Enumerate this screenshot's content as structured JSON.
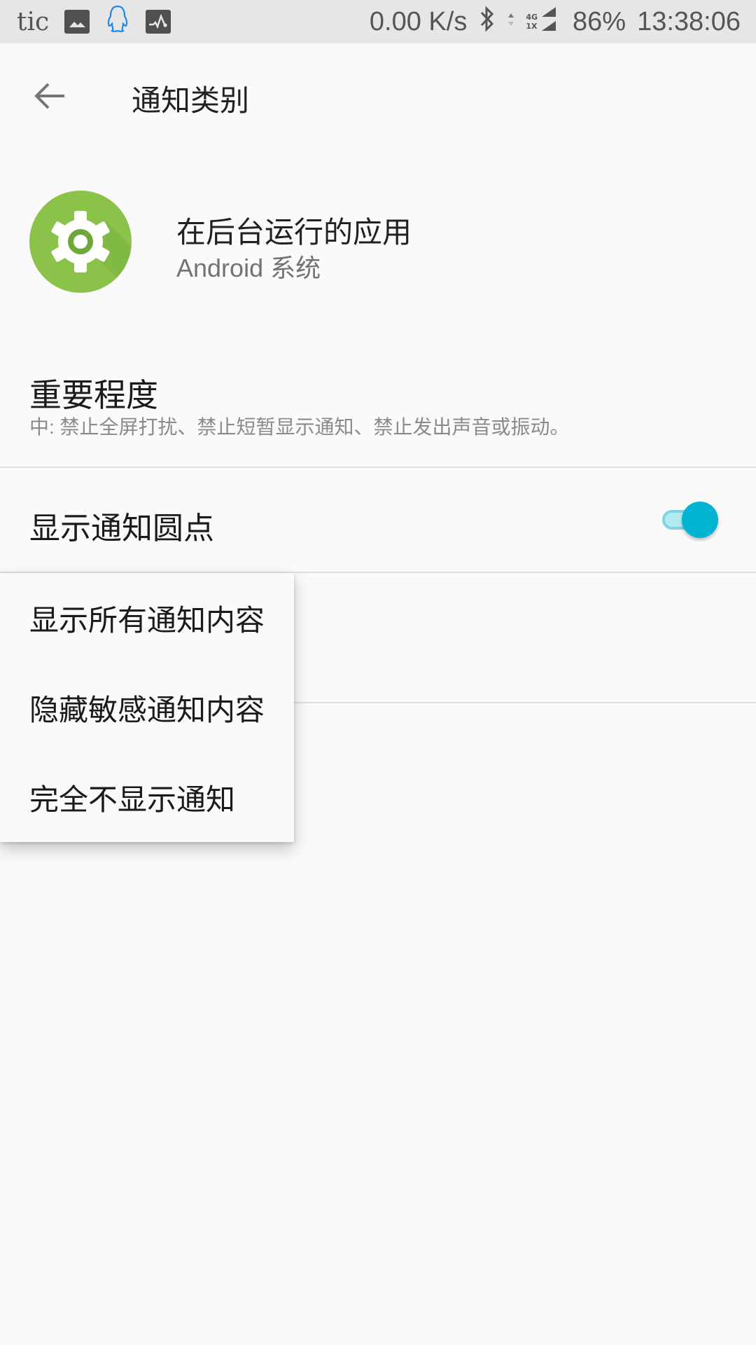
{
  "status_bar": {
    "carrier_text": "tic",
    "notification_icons": [
      "gallery-icon",
      "qq-penguin-icon",
      "activity-monitor-icon"
    ],
    "net_speed": "0.00 K/s",
    "bluetooth": "bluetooth-icon",
    "network_top": "4G",
    "network_bottom": "1X",
    "battery": "86%",
    "time": "13:38:06"
  },
  "app_bar": {
    "back_icon": "arrow-back-icon",
    "title": "通知类别"
  },
  "app_header": {
    "icon": "settings-gear-icon",
    "icon_color": "#8bc34a",
    "name": "在后台运行的应用",
    "subtitle": "Android 系统"
  },
  "importance": {
    "title": "重要程度",
    "summary": "中: 禁止全屏打扰、禁止短暂显示通知、禁止发出声音或振动。"
  },
  "notification_dot": {
    "label": "显示通知圆点",
    "enabled": true,
    "accent_color": "#00b4d2"
  },
  "lockscreen_menu": {
    "options": [
      {
        "label": "显示所有通知内容"
      },
      {
        "label": "隐藏敏感通知内容"
      },
      {
        "label": "完全不显示通知"
      }
    ]
  }
}
